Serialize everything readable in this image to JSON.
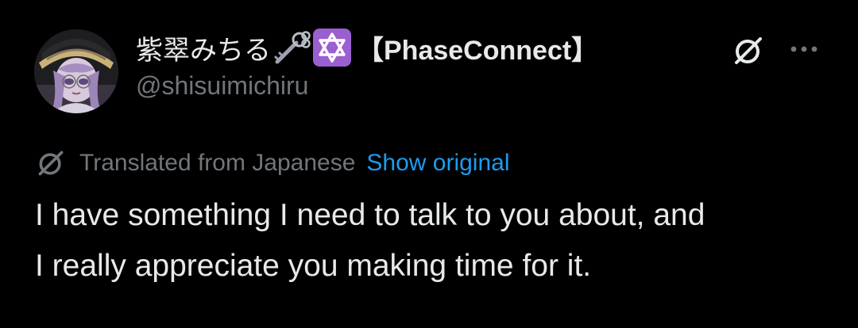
{
  "post": {
    "author": {
      "display_name": "紫翠みちる",
      "affiliation": "【PhaseConnect】",
      "handle": "@shisuimichiru",
      "emojis": [
        "key-emoji",
        "star-of-david-emoji"
      ]
    },
    "actions": {
      "grok_icon": "grok-icon",
      "more_icon": "more-horizontal-icon"
    },
    "translation": {
      "label": "Translated from Japanese",
      "link": "Show original"
    },
    "text": "I have something I need to talk to you about, and\nI really appreciate you making time for it."
  },
  "colors": {
    "background": "#000000",
    "primary_text": "#e7e9ea",
    "secondary_text": "#71767b",
    "link": "#1d9bf0",
    "emoji_purple": "#9a5fd0"
  }
}
